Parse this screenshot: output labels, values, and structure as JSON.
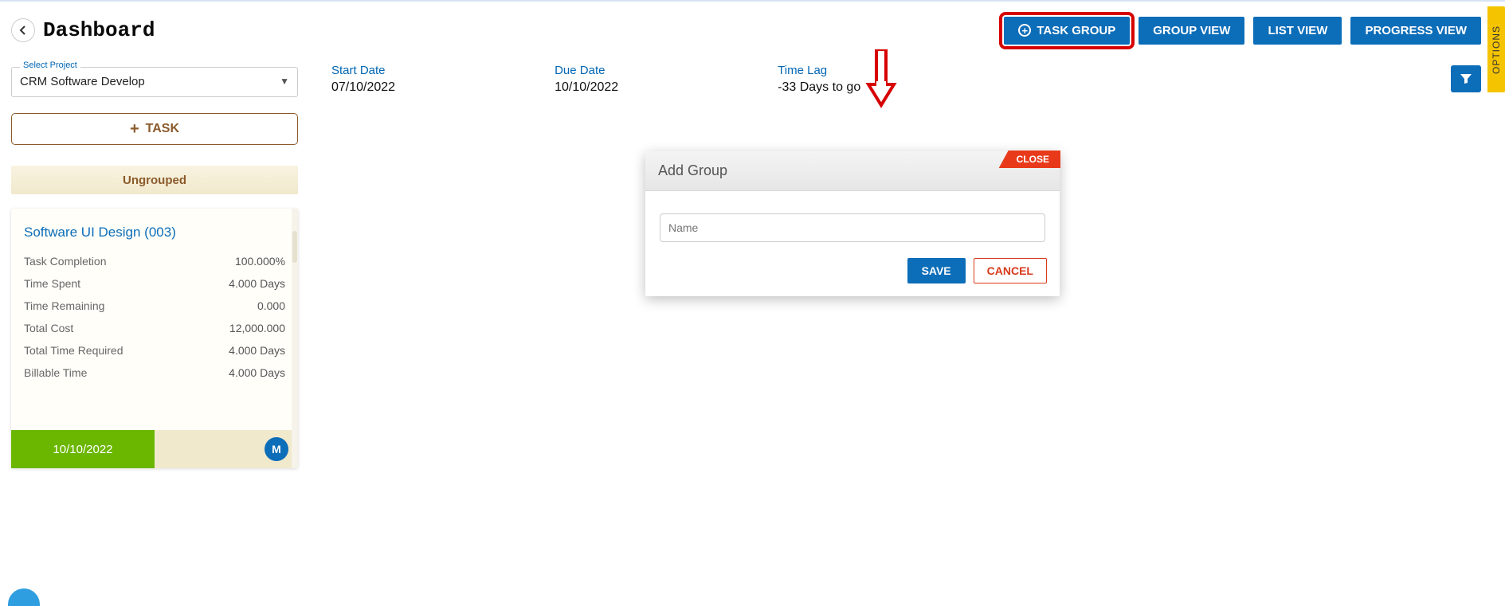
{
  "header": {
    "title": "Dashboard",
    "buttons": {
      "task_group": "TASK GROUP",
      "group_view": "GROUP VIEW",
      "list_view": "LIST VIEW",
      "progress_view": "PROGRESS VIEW"
    }
  },
  "project_select": {
    "label": "Select Project",
    "value": "CRM Software Develop"
  },
  "meta": {
    "start_label": "Start Date",
    "start_value": "07/10/2022",
    "due_label": "Due Date",
    "due_value": "10/10/2022",
    "lag_label": "Time Lag",
    "lag_value": "-33 Days to go"
  },
  "add_task_label": "TASK",
  "group_header": "Ungrouped",
  "task_card": {
    "title": "Software UI Design (003)",
    "rows": [
      {
        "label": "Task Completion",
        "value": "100.000%"
      },
      {
        "label": "Time Spent",
        "value": "4.000 Days"
      },
      {
        "label": "Time Remaining",
        "value": "0.000"
      },
      {
        "label": "Total Cost",
        "value": "12,000.000"
      },
      {
        "label": "Total Time Required",
        "value": "4.000 Days"
      },
      {
        "label": "Billable Time",
        "value": "4.000 Days"
      }
    ],
    "footer_date": "10/10/2022",
    "avatar_initial": "M"
  },
  "modal": {
    "close_label": "CLOSE",
    "title": "Add Group",
    "input_placeholder": "Name",
    "save_label": "SAVE",
    "cancel_label": "CANCEL"
  },
  "options_label": "OPTIONS"
}
